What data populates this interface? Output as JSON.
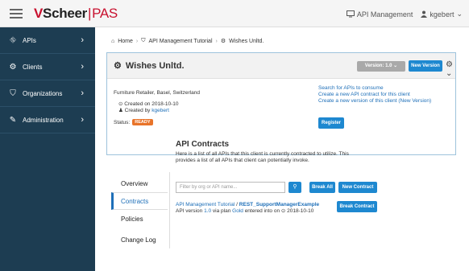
{
  "topbar": {
    "logo_brand": "Scheer",
    "logo_sep": "|",
    "logo_product": "PAS",
    "api_management": "API Management",
    "user": "kgebert"
  },
  "sidebar": {
    "items": [
      {
        "label": "APIs"
      },
      {
        "label": "Clients"
      },
      {
        "label": "Organizations"
      },
      {
        "label": "Administration"
      }
    ]
  },
  "breadcrumb": {
    "home": "Home",
    "org": "API Management Tutorial",
    "client": "Wishes Unltd."
  },
  "client": {
    "name": "Wishes Unltd.",
    "version_label": "Version: 1.0",
    "new_version": "New Version",
    "description": "Furniture Retailer, Basel, Switzerland",
    "created_on_prefix": "Created on",
    "created_on": "2018-10-10",
    "created_by_prefix": "Created by",
    "created_by": "kgebert",
    "status_label": "Status:",
    "status": "READY",
    "link_search": "Search for APIs to consume",
    "link_contract": "Create a new API contract for this client",
    "link_version": "Create a new version of this client (New Version)",
    "register": "Register"
  },
  "tabs": [
    {
      "label": "Overview"
    },
    {
      "label": "Contracts"
    },
    {
      "label": "Policies"
    },
    {
      "label": "Change Log"
    }
  ],
  "contracts": {
    "heading": "API Contracts",
    "intro": "Here is a list of all APIs that this client is currently contracted to utilize. This provides a list of all APIs that client can potentially invoke.",
    "filter_placeholder": "Filter by org or API name...",
    "break_all": "Break All",
    "new_contract": "New Contract",
    "row_org": "API Management Tutorial",
    "row_sep": "/",
    "row_api": "REST_SupportManagerExample",
    "row_prefix": "API version",
    "row_version": "1.0",
    "row_mid": "via plan",
    "row_plan": "Gold",
    "row_suffix": "entered into on",
    "row_date": "2018-10-10",
    "break_contract": "Break Contract"
  },
  "colors": {
    "sidebar": "#1d3d52",
    "accent": "#1e88d0",
    "badge": "#e8742a",
    "brand": "#c8102e"
  }
}
